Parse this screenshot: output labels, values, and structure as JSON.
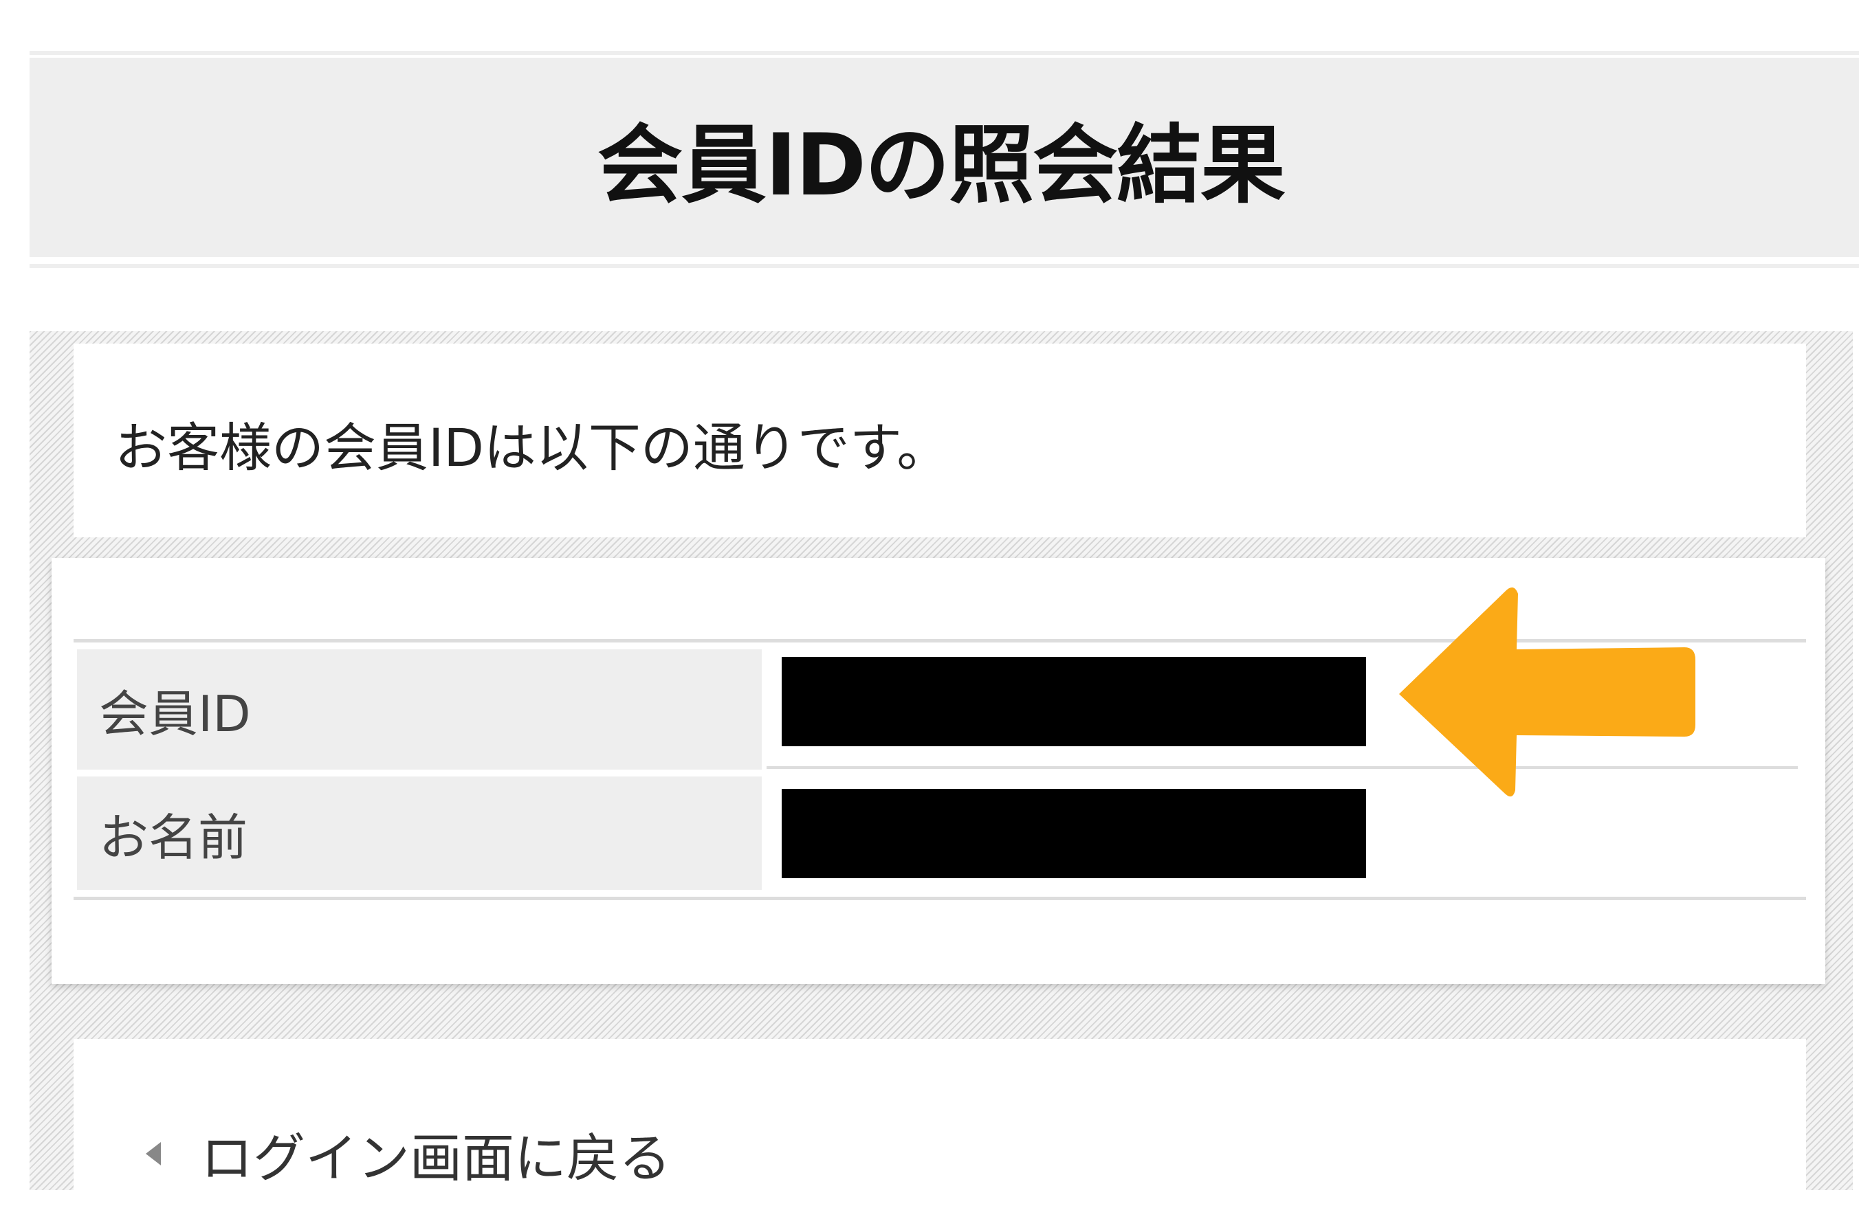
{
  "header": {
    "title": "会員IDの照会結果"
  },
  "intro": {
    "text": "お客様の会員IDは以下の通りです。"
  },
  "result_table": {
    "rows": [
      {
        "label": "会員ID",
        "value": ""
      },
      {
        "label": "お名前",
        "value": ""
      }
    ]
  },
  "footer": {
    "back_link_label": "ログイン画面に戻る",
    "back_icon": "triangle-left-icon"
  },
  "colors": {
    "annotation_arrow": "#FBAA17",
    "title_bar_bg": "#EEEEEE",
    "redaction": "#000000"
  }
}
